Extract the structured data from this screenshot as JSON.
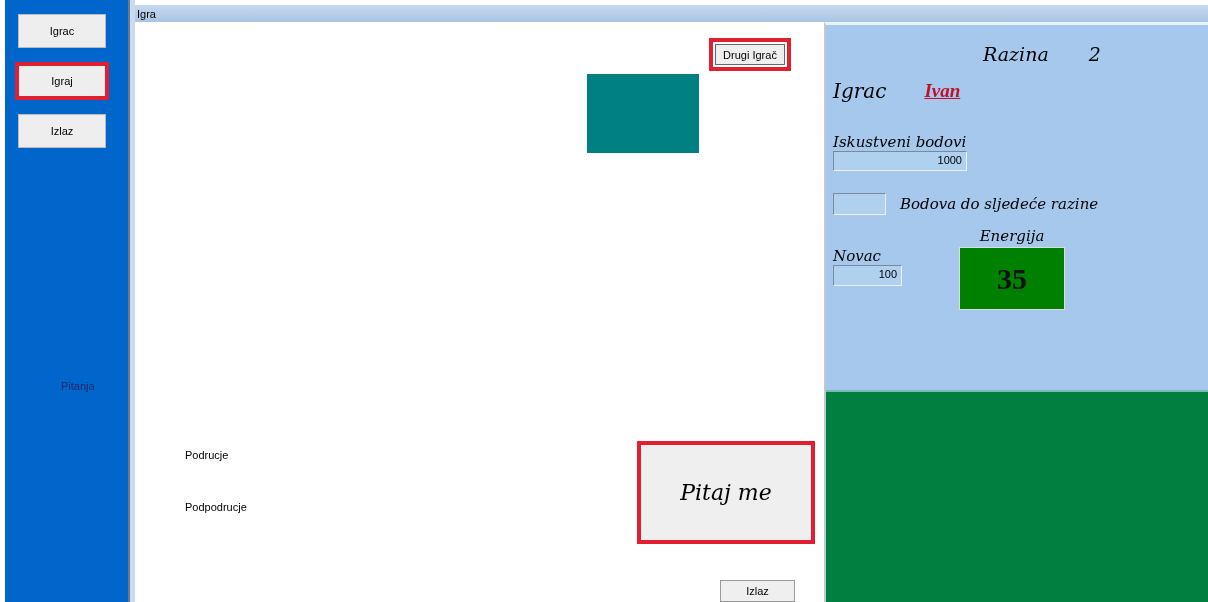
{
  "sidebar": {
    "buttons": [
      {
        "label": "Igrac",
        "highlighted": false
      },
      {
        "label": "Igraj",
        "highlighted": true
      },
      {
        "label": "Izlaz",
        "highlighted": false
      }
    ],
    "label": "Pitanja"
  },
  "window": {
    "title": "Igra"
  },
  "game": {
    "other_player_button": {
      "label": "Drugi Igrač",
      "highlighted": true
    },
    "labels": [
      "Podrucje",
      "Podpodrucje"
    ],
    "ask_button": {
      "label": "Pitaj me",
      "highlighted": true
    },
    "exit_button": {
      "label": "Izlaz",
      "highlighted": false
    }
  },
  "player": {
    "level_label": "Razina",
    "level_value": "2",
    "player_label": "Igrac",
    "player_name": "Ivan",
    "xp_label": "Iskustveni bodovi",
    "xp_value": "1000",
    "next_label": "Bodova do sljedeće razine",
    "energy_label": "Energija",
    "energy_value": "35",
    "money_label": "Novac",
    "money_value": "100"
  }
}
